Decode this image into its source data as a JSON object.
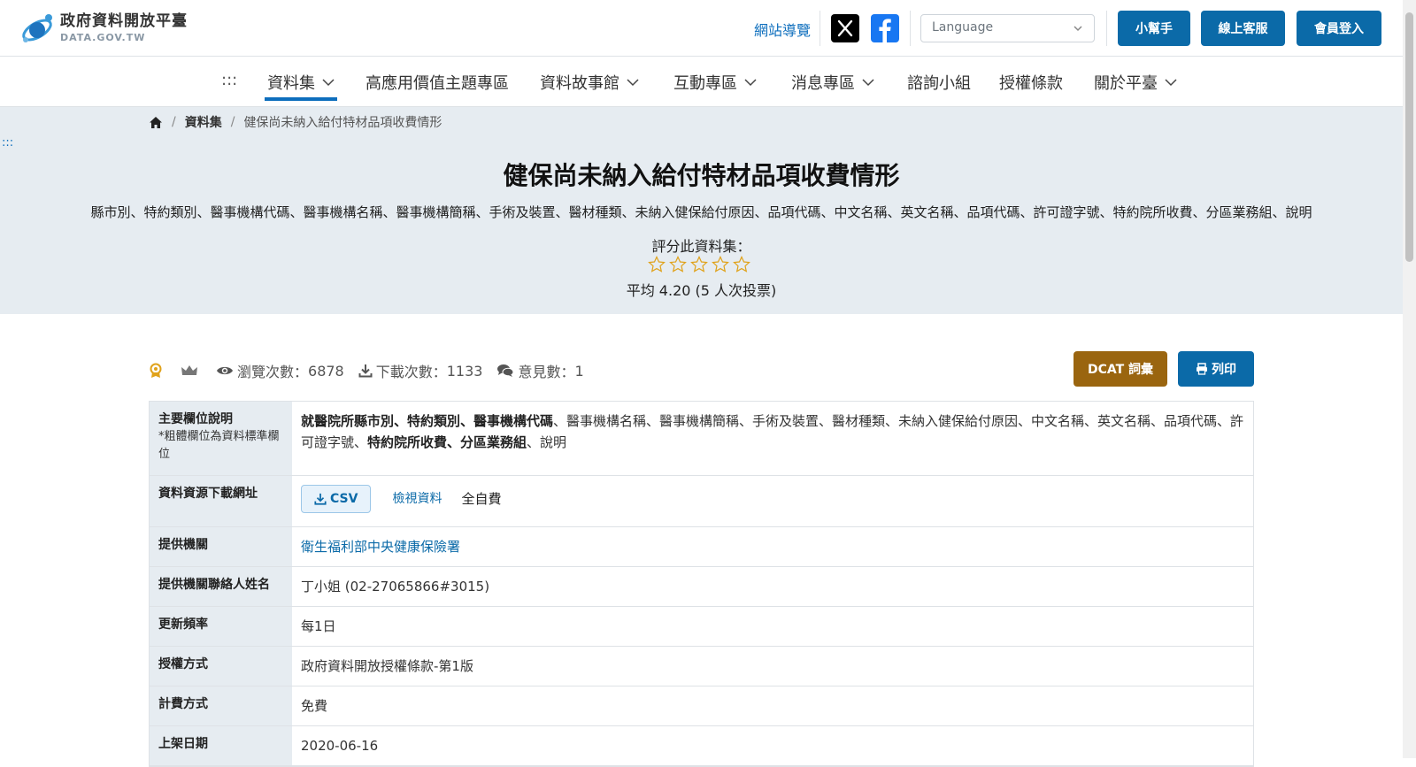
{
  "header": {
    "logo_title": "政府資料開放平臺",
    "logo_sub": "DATA.GOV.TW",
    "sitemap": "網站導覽",
    "language_placeholder": "Language",
    "buttons": {
      "helper": "小幫手",
      "support": "線上客服",
      "login": "會員登入"
    },
    "colors": {
      "brand": "#0b6aa8",
      "dcat": "#9a650f",
      "hero_bg": "#e6ecf1"
    }
  },
  "nav": {
    "dots": ":::",
    "items": [
      "資料集",
      "高應用價值主題專區",
      "資料故事館",
      "互動專區",
      "消息專區",
      "諮詢小組",
      "授權條款",
      "關於平臺"
    ],
    "active": "資料集"
  },
  "breadcrumb": {
    "home": "home-icon",
    "dataset": "資料集",
    "current": "健保尚未納入給付特材品項收費情形"
  },
  "hero": {
    "dots": ":::",
    "title": "健保尚未納入給付特材品項收費情形",
    "fields": "縣市別、特約類別、醫事機構代碼、醫事機構名稱、醫事機構簡稱、手術及裝置、醫材種類、未納入健保給付原因、品項代碼、中文名稱、英文名稱、品項代碼、許可證字號、特約院所收費、分區業務組、說明",
    "rate_label": "評分此資料集：",
    "rating_stars": 5,
    "average": "平均 4.20 (5 人次投票)"
  },
  "stats": {
    "views_label": "瀏覽次數：",
    "views": "6878",
    "downloads_label": "下載次數：",
    "downloads": "1133",
    "comments_label": "意見數：",
    "comments": "1",
    "dcat": "DCAT 詞彙",
    "print": "列印"
  },
  "info": {
    "fields_th": "主要欄位說明",
    "fields_note": "*粗體欄位為資料標準欄位",
    "fields_bold1": "就醫院所縣市別、特約類別、醫事機構代碼",
    "fields_normal1": "、醫事機構名稱、醫事機構簡稱、手術及裝置、醫材種類、未納入健保給付原因、中文名稱、英文名稱、品項代碼、許可證字號、",
    "fields_bold2": "特約院所收費、分區業務組",
    "fields_normal2": "、說明",
    "download_th": "資料資源下載網址",
    "csv": "CSV",
    "view": "檢視資料",
    "fee_note": "全自費",
    "provider_th": "提供機關",
    "provider": "衛生福利部中央健康保險署",
    "contact_th": "提供機關聯絡人姓名",
    "contact": "丁小姐 (02-27065866#3015)",
    "freq_th": "更新頻率",
    "freq": "每1日",
    "license_th": "授權方式",
    "license": "政府資料開放授權條款-第1版",
    "fee_th": "計費方式",
    "fee": "免費",
    "date_th": "上架日期",
    "date": "2020-06-16"
  }
}
